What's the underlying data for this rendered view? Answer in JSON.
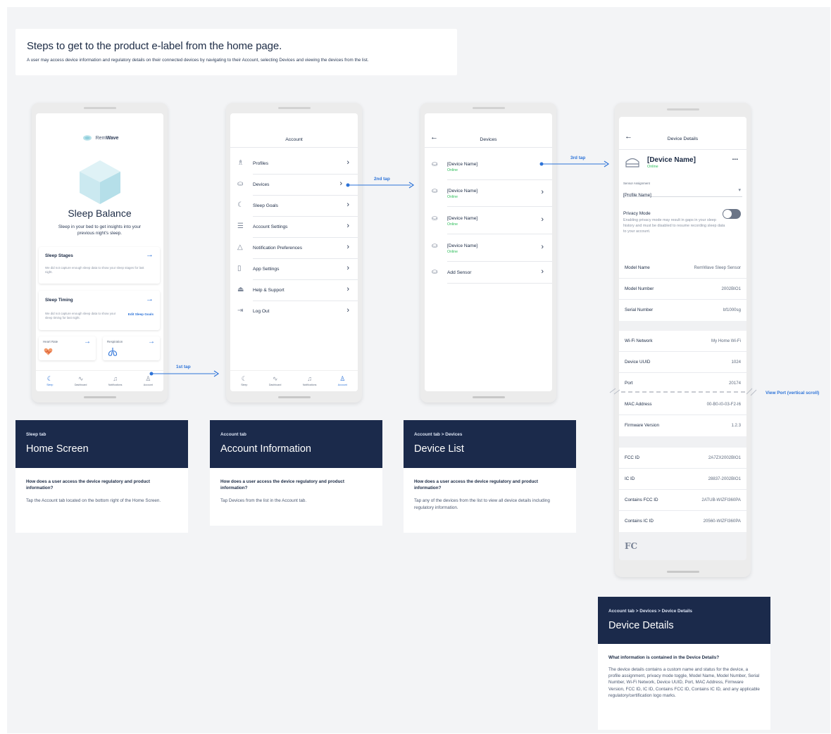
{
  "header": {
    "title": "Steps to get to the product e-label from the home page.",
    "subtitle": "A user may access device information and regulatory details on their connected devices by navigating to their Account, selecting Devices and viewing the devices from the list."
  },
  "home": {
    "brand_prefix": "Rem",
    "brand_suffix": "Wave",
    "title": "Sleep Balance",
    "subtitle": "Sleep in your bed to get insights into your previous night's sleep.",
    "cards": [
      {
        "title": "Sleep Stages",
        "body": "We did not capture enough sleep data to show your sleep stages for last night."
      },
      {
        "title": "Sleep Timing",
        "body": "We did not capture enough sleep data to show your sleep timing for last night.",
        "link": "Edit Sleep Goals"
      }
    ],
    "mini_cards": [
      {
        "title": "Heart Rate"
      },
      {
        "title": "Respiration"
      }
    ]
  },
  "tabs": [
    {
      "label": "Sleep",
      "icon": "moon-icon"
    },
    {
      "label": "Dashboard",
      "icon": "pulse-icon"
    },
    {
      "label": "Notifications",
      "icon": "bell-icon"
    },
    {
      "label": "Account",
      "icon": "person-icon"
    }
  ],
  "account": {
    "title": "Account",
    "items": [
      {
        "label": "Profiles",
        "icon": "profile-icon"
      },
      {
        "label": "Devices",
        "icon": "bed-icon"
      },
      {
        "label": "Sleep Goals",
        "icon": "moon-icon"
      },
      {
        "label": "Account Settings",
        "icon": "sliders-icon"
      },
      {
        "label": "Notification Preferences",
        "icon": "bell-icon"
      },
      {
        "label": "App Settings",
        "icon": "phone-icon"
      },
      {
        "label": "Help & Support",
        "icon": "help-icon"
      },
      {
        "label": "Log Out",
        "icon": "logout-icon"
      }
    ]
  },
  "devices": {
    "title": "Devices",
    "items": [
      {
        "name": "[Device Name]",
        "status": "Online"
      },
      {
        "name": "[Device Name]",
        "status": "Online"
      },
      {
        "name": "[Device Name]",
        "status": "Online"
      },
      {
        "name": "[Device Name]",
        "status": "Online"
      }
    ],
    "add_label": "Add Sensor"
  },
  "details": {
    "title": "Device Details",
    "device_name": "[Device Name]",
    "status": "Online",
    "more": "...",
    "sensor_label": "Sensor Assignment",
    "sensor_value": "[Profile Name]",
    "privacy_title": "Privacy Mode",
    "privacy_body": "Enabling privacy mode may result in gaps in your sleep history and must be disabled to resume recording sleep data to your account.",
    "group1": [
      {
        "k": "Model Name",
        "v": "RemWave Sleep Sensor"
      },
      {
        "k": "Model Number",
        "v": "2002BIO1"
      },
      {
        "k": "Serial Number",
        "v": "bf1000sg"
      }
    ],
    "group2": [
      {
        "k": "Wi-Fi Network",
        "v": "My Home Wi-Fi"
      },
      {
        "k": "Device UUID",
        "v": "1024"
      },
      {
        "k": "Port",
        "v": "20174"
      },
      {
        "k": "MAC Address",
        "v": "00-B0-I0-03-F2-I6"
      },
      {
        "k": "Firmware Version",
        "v": "1.2.3"
      }
    ],
    "group3": [
      {
        "k": "FCC ID",
        "v": "2A7ZX2002BIO1"
      },
      {
        "k": "IC ID",
        "v": "28837-2002BIO1"
      },
      {
        "k": "Contains FCC ID",
        "v": "2ATUB-WIZFI360PA"
      },
      {
        "k": "Contains IC ID",
        "v": "20560-WIZFI360PA"
      }
    ],
    "fcc_mark": "FC"
  },
  "annotations": {
    "tap1": "1st tap",
    "tap2": "2nd tap",
    "tap3": "3rd tap",
    "viewport": "View Port (vertical scroll)"
  },
  "info_cards": [
    {
      "eyebrow": "Sleep tab",
      "title": "Home Screen",
      "question": "How does a user access the device regulatory and product information?",
      "answer": "Tap the Account tab located on the bottom right of the Home Screen."
    },
    {
      "eyebrow": "Account tab",
      "title": "Account Information",
      "question": "How does a user access the device regulatory and product information?",
      "answer": "Tap Devices from the list in the Account tab."
    },
    {
      "eyebrow": "Account tab > Devices",
      "title": "Device List",
      "question": "How does a user access the device regulatory and product information?",
      "answer": "Tap any of the devices from the list to view all device details including regulatory information."
    },
    {
      "eyebrow": "Account tab > Devices > Device Details",
      "title": "Device Details",
      "question": "What information is contained in the Device Details?",
      "answer": "The device details contains a custom name and status for the device, a profile assignment, privacy mode toggle, Model Name, Model Number, Serial Number, Wi-Fi Network, Device UUID, Port, MAC Address, Firmware Version, FCC ID, IC ID, Contains FCC ID, Contains IC ID, and any applicable regulatory/certification logo marks."
    }
  ],
  "colors": {
    "navy": "#1b2a4b",
    "accent": "#2d73d8",
    "online": "#2ebd5b",
    "background": "#f3f4f6"
  }
}
